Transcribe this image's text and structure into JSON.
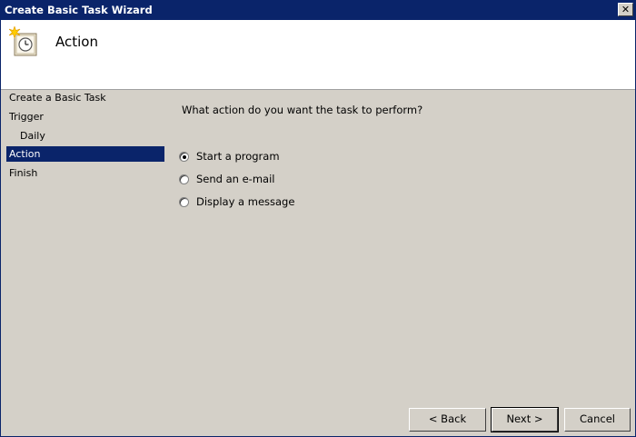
{
  "window": {
    "title": "Create Basic Task Wizard",
    "close_glyph": "✕"
  },
  "header": {
    "title": "Action",
    "icon": "task-scheduler-clock-icon"
  },
  "nav": {
    "items": [
      {
        "label": "Create a Basic Task",
        "selected": false,
        "indent": false
      },
      {
        "label": "Trigger",
        "selected": false,
        "indent": false
      },
      {
        "label": "Daily",
        "selected": false,
        "indent": true
      },
      {
        "label": "Action",
        "selected": true,
        "indent": false
      },
      {
        "label": "Finish",
        "selected": false,
        "indent": false
      }
    ]
  },
  "main": {
    "question": "What action do you want the task to perform?",
    "options": [
      {
        "label": "Start a program",
        "accel": "S",
        "checked": true
      },
      {
        "label": "Send an e-mail",
        "accel": "S",
        "checked": false
      },
      {
        "label": "Display a message",
        "accel": "m",
        "checked": false
      }
    ]
  },
  "buttons": {
    "back": "< Back",
    "next": "Next >",
    "cancel": "Cancel"
  },
  "colors": {
    "titlebar": "#0a246a",
    "selection": "#0a246a",
    "face": "#d4d0c8"
  }
}
